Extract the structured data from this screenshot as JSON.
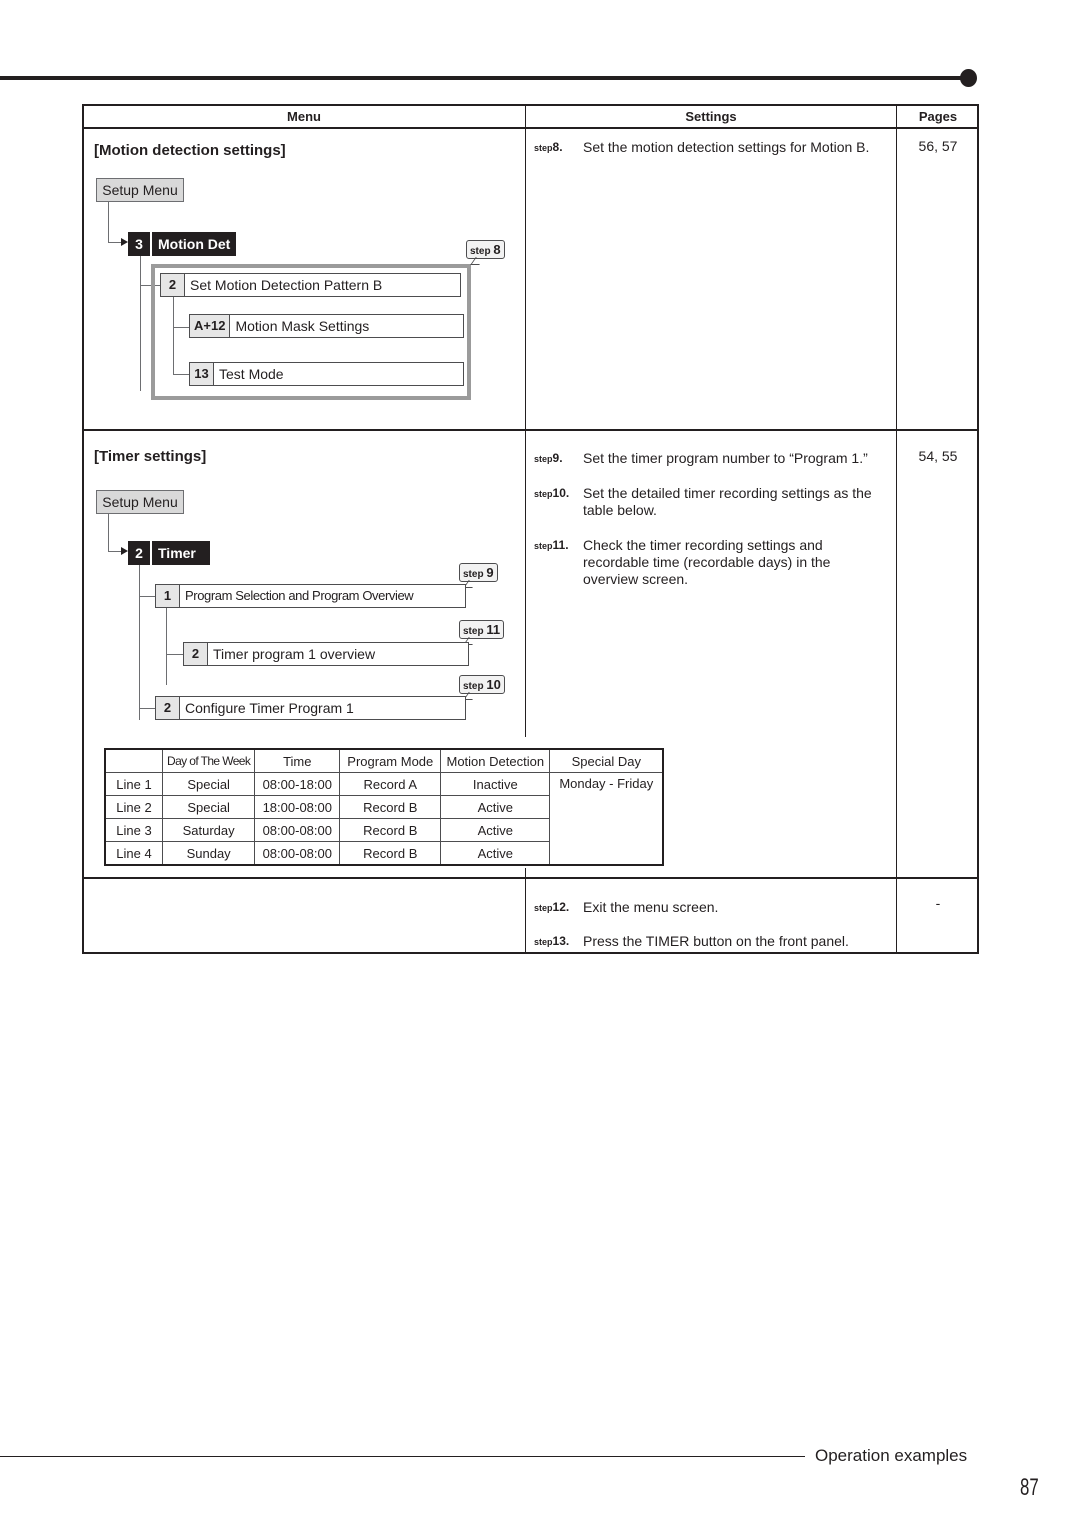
{
  "header": {
    "menu_col": "Menu",
    "settings_col": "Settings",
    "pages_col": "Pages"
  },
  "motion": {
    "title": "[Motion detection settings]",
    "setup_menu": "Setup Menu",
    "parent": {
      "num": "3",
      "label": "Motion Det"
    },
    "callout": {
      "prefix": "step",
      "num": "8"
    },
    "items": [
      {
        "num": "2",
        "label": "Set Motion Detection Pattern B"
      },
      {
        "num": "A+12",
        "label": "Motion Mask Settings"
      },
      {
        "num": "13",
        "label": "Test Mode"
      }
    ],
    "steps": [
      {
        "prefix": "step",
        "num": "8.",
        "text": "Set the motion detection settings for Motion B."
      }
    ],
    "pages": "56, 57"
  },
  "timer": {
    "title": "[Timer settings]",
    "setup_menu": "Setup Menu",
    "parent": {
      "num": "2",
      "label": "Timer"
    },
    "items": [
      {
        "num": "1",
        "label": "Program Selection and Program Overview",
        "callout": "9"
      },
      {
        "num": "2",
        "label": "Timer program 1 overview",
        "callout": "11"
      },
      {
        "num": "2",
        "label": "Configure Timer Program 1",
        "callout": "10"
      }
    ],
    "callout_prefix": "step",
    "steps": [
      {
        "prefix": "step",
        "num": "9.",
        "text": "Set the timer program number to “Program 1.”"
      },
      {
        "prefix": "step",
        "num": "10.",
        "text": "Set the detailed timer recording settings as the table below."
      },
      {
        "prefix": "step",
        "num": "11.",
        "text": "Check the timer recording settings and recordable time (recordable days) in the overview screen."
      }
    ],
    "pages": "54, 55",
    "table": {
      "headers": [
        "",
        "Day of The Week",
        "Time",
        "Program Mode",
        "Motion Detection",
        "Special Day"
      ],
      "rows": [
        [
          "Line 1",
          "Special",
          "08:00-18:00",
          "Record A",
          "Inactive"
        ],
        [
          "Line 2",
          "Special",
          "18:00-08:00",
          "Record B",
          "Active"
        ],
        [
          "Line 3",
          "Saturday",
          "08:00-08:00",
          "Record B",
          "Active"
        ],
        [
          "Line 4",
          "Sunday",
          "08:00-08:00",
          "Record B",
          "Active"
        ]
      ],
      "special_day": "Monday - Friday"
    }
  },
  "exit": {
    "steps": [
      {
        "prefix": "step",
        "num": "12.",
        "text": "Exit the menu screen."
      },
      {
        "prefix": "step",
        "num": "13.",
        "text": "Press the TIMER button on the front panel."
      }
    ],
    "pages": "-"
  },
  "footer": {
    "section": "Operation examples",
    "page_number": "87"
  }
}
